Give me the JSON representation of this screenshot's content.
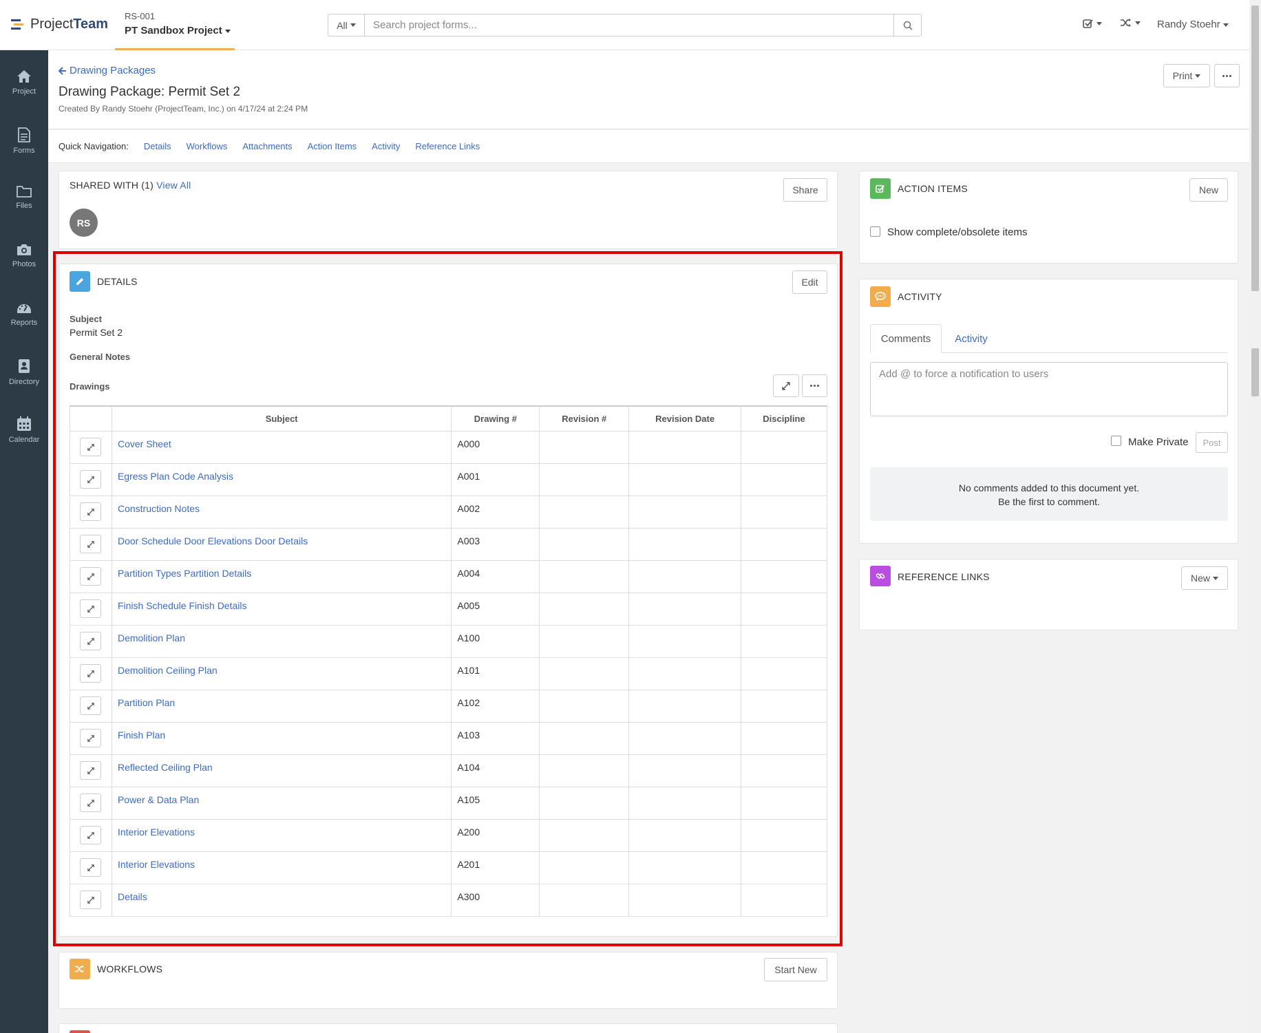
{
  "topbar": {
    "logo_prefix": "Project",
    "logo_suffix": "Team",
    "project_code": "RS-001",
    "project_name": "PT Sandbox Project",
    "search_scope": "All",
    "search_placeholder": "Search project forms...",
    "user_name": "Randy Stoehr"
  },
  "sidebar": {
    "items": [
      {
        "label": "Project",
        "icon": "home-icon"
      },
      {
        "label": "Forms",
        "icon": "document-icon"
      },
      {
        "label": "Files",
        "icon": "folder-icon"
      },
      {
        "label": "Photos",
        "icon": "camera-icon"
      },
      {
        "label": "Reports",
        "icon": "dashboard-icon"
      },
      {
        "label": "Directory",
        "icon": "contact-book-icon"
      },
      {
        "label": "Calendar",
        "icon": "calendar-icon"
      }
    ]
  },
  "header": {
    "back_label": "Drawing Packages",
    "title": "Drawing Package: Permit Set 2",
    "created_by": "Created By Randy Stoehr (ProjectTeam, Inc.) on 4/17/24 at 2:24 PM",
    "print_label": "Print"
  },
  "quicknav": {
    "label": "Quick Navigation:",
    "links": [
      "Details",
      "Workflows",
      "Attachments",
      "Action Items",
      "Activity",
      "Reference Links"
    ]
  },
  "shared": {
    "title": "SHARED WITH (1)",
    "view_all": "View All",
    "share_label": "Share",
    "avatar_initials": "RS"
  },
  "details": {
    "title": "DETAILS",
    "edit_label": "Edit",
    "subject_label": "Subject",
    "subject_value": "Permit Set 2",
    "notes_label": "General Notes",
    "drawings_label": "Drawings",
    "columns": [
      "Subject",
      "Drawing #",
      "Revision #",
      "Revision Date",
      "Discipline"
    ],
    "rows": [
      {
        "subject": "Cover Sheet",
        "drawing": "A000",
        "revision": "",
        "date": "",
        "discipline": ""
      },
      {
        "subject": "Egress Plan Code Analysis",
        "drawing": "A001",
        "revision": "",
        "date": "",
        "discipline": ""
      },
      {
        "subject": "Construction Notes",
        "drawing": "A002",
        "revision": "",
        "date": "",
        "discipline": ""
      },
      {
        "subject": "Door Schedule Door Elevations Door Details",
        "drawing": "A003",
        "revision": "",
        "date": "",
        "discipline": ""
      },
      {
        "subject": "Partition Types Partition Details",
        "drawing": "A004",
        "revision": "",
        "date": "",
        "discipline": ""
      },
      {
        "subject": "Finish Schedule Finish Details",
        "drawing": "A005",
        "revision": "",
        "date": "",
        "discipline": ""
      },
      {
        "subject": "Demolition Plan",
        "drawing": "A100",
        "revision": "",
        "date": "",
        "discipline": ""
      },
      {
        "subject": "Demolition Ceiling Plan",
        "drawing": "A101",
        "revision": "",
        "date": "",
        "discipline": ""
      },
      {
        "subject": "Partition Plan",
        "drawing": "A102",
        "revision": "",
        "date": "",
        "discipline": ""
      },
      {
        "subject": "Finish Plan",
        "drawing": "A103",
        "revision": "",
        "date": "",
        "discipline": ""
      },
      {
        "subject": "Reflected Ceiling Plan",
        "drawing": "A104",
        "revision": "",
        "date": "",
        "discipline": ""
      },
      {
        "subject": "Power & Data Plan",
        "drawing": "A105",
        "revision": "",
        "date": "",
        "discipline": ""
      },
      {
        "subject": "Interior Elevations",
        "drawing": "A200",
        "revision": "",
        "date": "",
        "discipline": ""
      },
      {
        "subject": "Interior Elevations",
        "drawing": "A201",
        "revision": "",
        "date": "",
        "discipline": ""
      },
      {
        "subject": "Details",
        "drawing": "A300",
        "revision": "",
        "date": "",
        "discipline": ""
      }
    ]
  },
  "workflows": {
    "title": "WORKFLOWS",
    "start_label": "Start New"
  },
  "action_items": {
    "title": "ACTION ITEMS",
    "new_label": "New",
    "show_complete_label": "Show complete/obsolete items"
  },
  "activity": {
    "title": "ACTIVITY",
    "tabs": [
      "Comments",
      "Activity"
    ],
    "comment_placeholder": "Add @ to force a notification to users",
    "make_private_label": "Make Private",
    "post_label": "Post",
    "empty_line1": "No comments added to this document yet.",
    "empty_line2": "Be the first to comment."
  },
  "reference_links": {
    "title": "REFERENCE LINKS",
    "new_label": "New"
  },
  "colors": {
    "accent": "#3c6cc4",
    "sidebar": "#2d3b47",
    "details_badge": "#4ba3e0",
    "action_badge": "#5cb85c",
    "activity_badge": "#f0ad4e",
    "links_badge": "#b94ee0",
    "workflow_badge": "#f0ad4e",
    "highlight": "#e00000"
  }
}
